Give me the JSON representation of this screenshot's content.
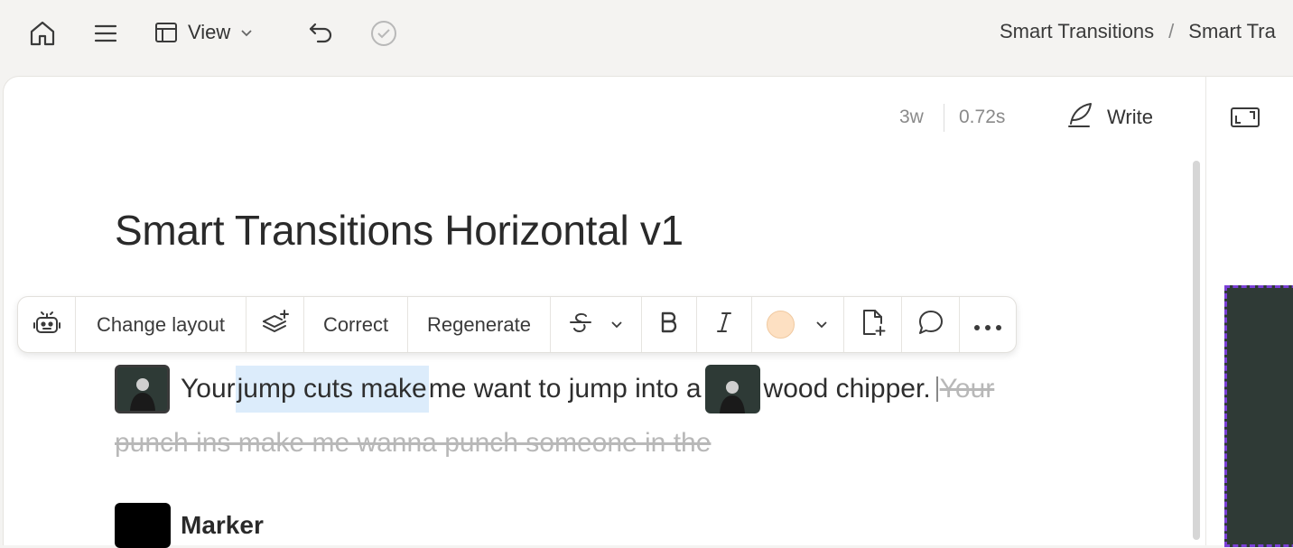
{
  "topbar": {
    "view_label": "View",
    "breadcrumb": [
      "Smart Transitions",
      "/",
      "Smart Tra"
    ]
  },
  "editor": {
    "word_count": "3w",
    "duration": "0.72s",
    "write_label": "Write",
    "title": "Smart Transitions Horizontal v1"
  },
  "toolbar": {
    "change_layout": "Change layout",
    "correct": "Correct",
    "regenerate": "Regenerate",
    "highlight_color": "#fde0c2"
  },
  "script": {
    "before_highlight": "Your ",
    "highlight": "jump cuts make",
    "after_highlight": " me want to jump into a ",
    "after_thumb": " wood chipper.",
    "struck_line1": "Your",
    "struck_line2": "punch ins make me wanna punch someone in the "
  },
  "marker": {
    "label": "Marker"
  },
  "colors": {
    "selection": "#dcecfb",
    "preview_border": "#7a3fd6"
  }
}
